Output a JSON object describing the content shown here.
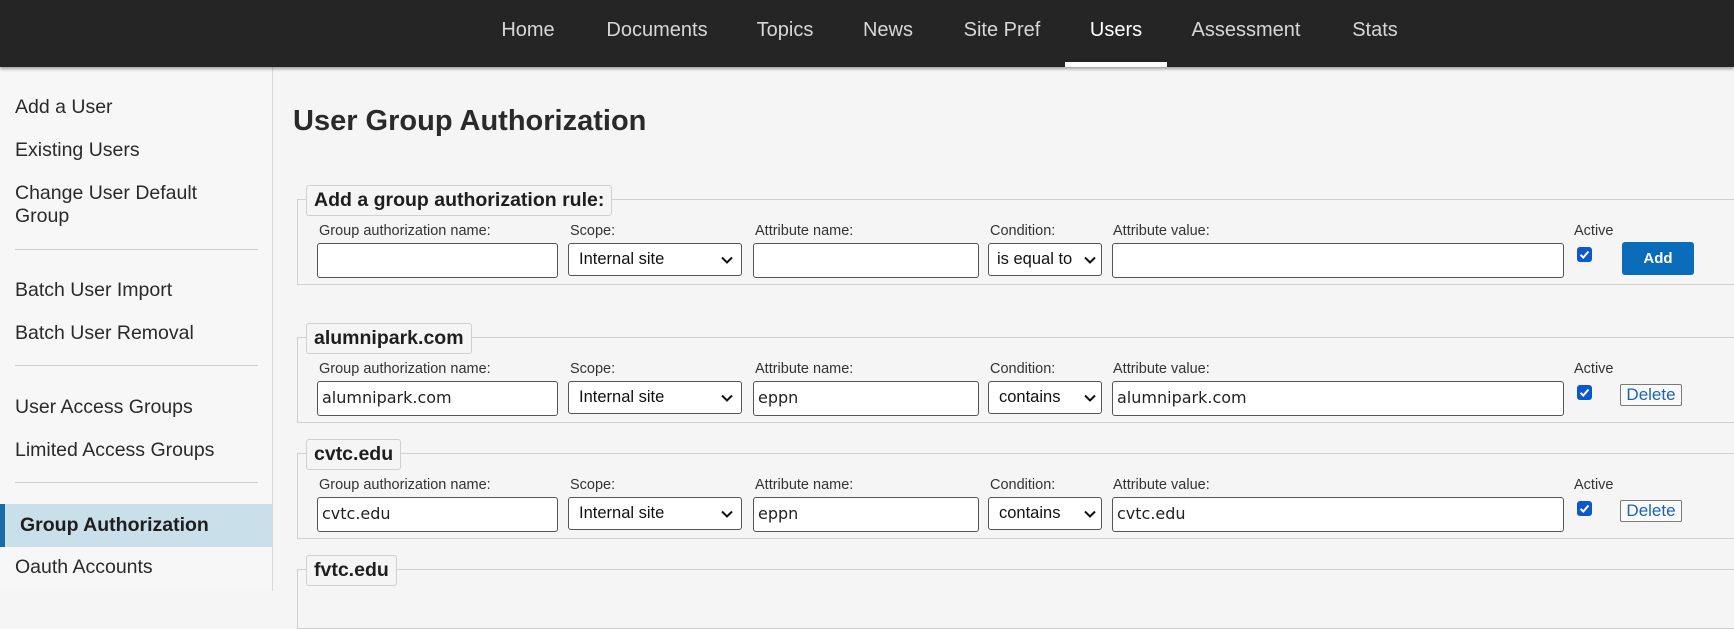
{
  "topnav": {
    "items": [
      {
        "label": "Home"
      },
      {
        "label": "Documents"
      },
      {
        "label": "Topics"
      },
      {
        "label": "News"
      },
      {
        "label": "Site Pref"
      },
      {
        "label": "Users"
      },
      {
        "label": "Assessment"
      },
      {
        "label": "Stats"
      }
    ],
    "active": "Users"
  },
  "sidebar": {
    "items": [
      {
        "label": "Add a User"
      },
      {
        "label": "Existing Users"
      },
      {
        "label": "Change User Default Group"
      },
      {
        "label": "Batch User Import"
      },
      {
        "label": "Batch User Removal"
      },
      {
        "label": "User Access Groups"
      },
      {
        "label": "Limited Access Groups"
      },
      {
        "label": "Group Authorization"
      },
      {
        "label": "Oauth Accounts"
      }
    ],
    "active": "Group Authorization"
  },
  "page": {
    "title": "User Group Authorization"
  },
  "labels": {
    "group_name": "Group authorization name:",
    "scope": "Scope:",
    "attribute_name": "Attribute name:",
    "condition": "Condition:",
    "attribute_value": "Attribute value:",
    "active": "Active"
  },
  "add_rule": {
    "legend": "Add a group authorization rule:",
    "group_name": "",
    "scope": "Internal site",
    "attribute_name": "",
    "condition": "is equal to",
    "attribute_value": "",
    "active": true,
    "button_label": "Add"
  },
  "rules": [
    {
      "legend": "alumnipark.com",
      "group_name": "alumnipark.com",
      "scope": "Internal site",
      "attribute_name": "eppn",
      "condition": "contains",
      "attribute_value": "alumnipark.com",
      "active": true,
      "button_label": "Delete"
    },
    {
      "legend": "cvtc.edu",
      "group_name": "cvtc.edu",
      "scope": "Internal site",
      "attribute_name": "eppn",
      "condition": "contains",
      "attribute_value": "cvtc.edu",
      "active": true,
      "button_label": "Delete"
    },
    {
      "legend": "fvtc.edu"
    }
  ],
  "colors": {
    "nav_bg": "#252525",
    "accent": "#0a6bb8",
    "sidebar_active_bg": "#c9dfe9",
    "sidebar_active_bar": "#1a6aa5",
    "checkbox": "#0b57d0"
  }
}
